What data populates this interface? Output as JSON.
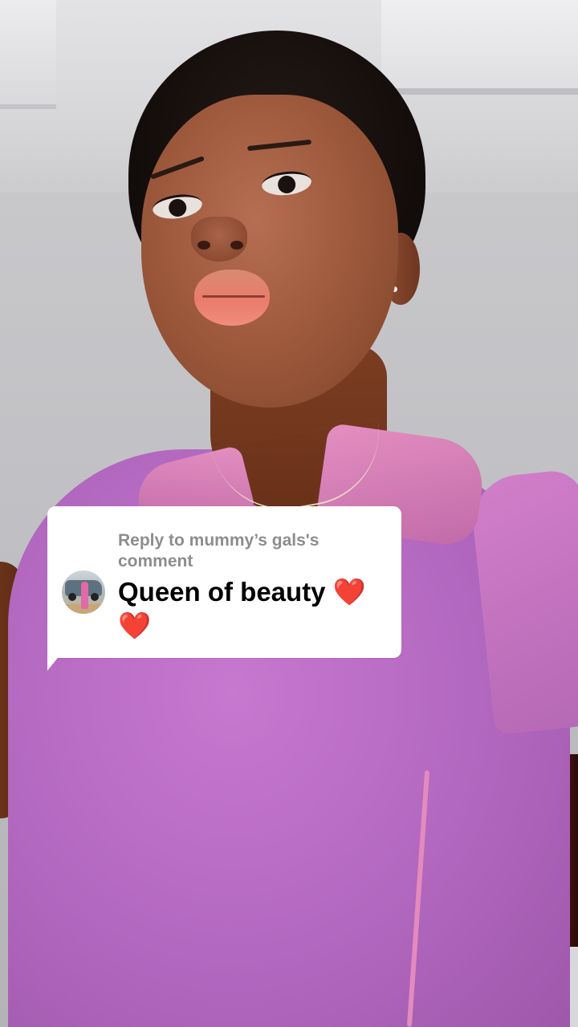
{
  "reply_card": {
    "header": "Reply to mummy’s gals's comment",
    "comment": "Queen of beauty ❤️❤️",
    "avatar_icon": "commenter-avatar"
  },
  "colors": {
    "card_background": "#ffffff",
    "header_text": "#8d8d8f",
    "comment_text": "#000000"
  }
}
